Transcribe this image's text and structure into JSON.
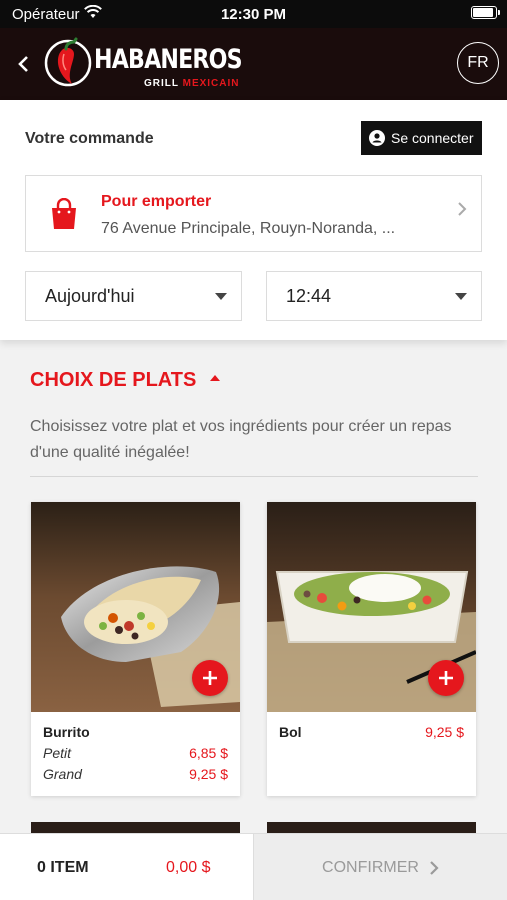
{
  "status_bar": {
    "carrier": "Opérateur",
    "time": "12:30 PM"
  },
  "header": {
    "back_icon": "chevron-left-icon",
    "brand": "HABANEROS",
    "tagline_left": "GRILL",
    "tagline_right": "MEXICAIN",
    "language": "FR"
  },
  "order": {
    "title": "Votre commande",
    "login_label": "Se connecter",
    "mode_title": "Pour emporter",
    "address": "76 Avenue Principale, Rouyn-Noranda, ...",
    "day": "Aujourd'hui",
    "time": "12:44"
  },
  "section": {
    "title": "CHOIX DE PLATS",
    "description": "Choisissez votre plat et vos ingrédients pour créer un repas d'une qualité inégalée!"
  },
  "products": [
    {
      "name": "Burrito",
      "sizes": [
        {
          "label": "Petit",
          "price": "6,85 $"
        },
        {
          "label": "Grand",
          "price": "9,25 $"
        }
      ]
    },
    {
      "name": "Bol",
      "price": "9,25 $"
    }
  ],
  "cart": {
    "items": "0 ITEM",
    "total": "0,00 $",
    "confirm_label": "CONFIRMER"
  },
  "colors": {
    "accent": "#e5171d",
    "header_bg": "#1a0c0c"
  }
}
